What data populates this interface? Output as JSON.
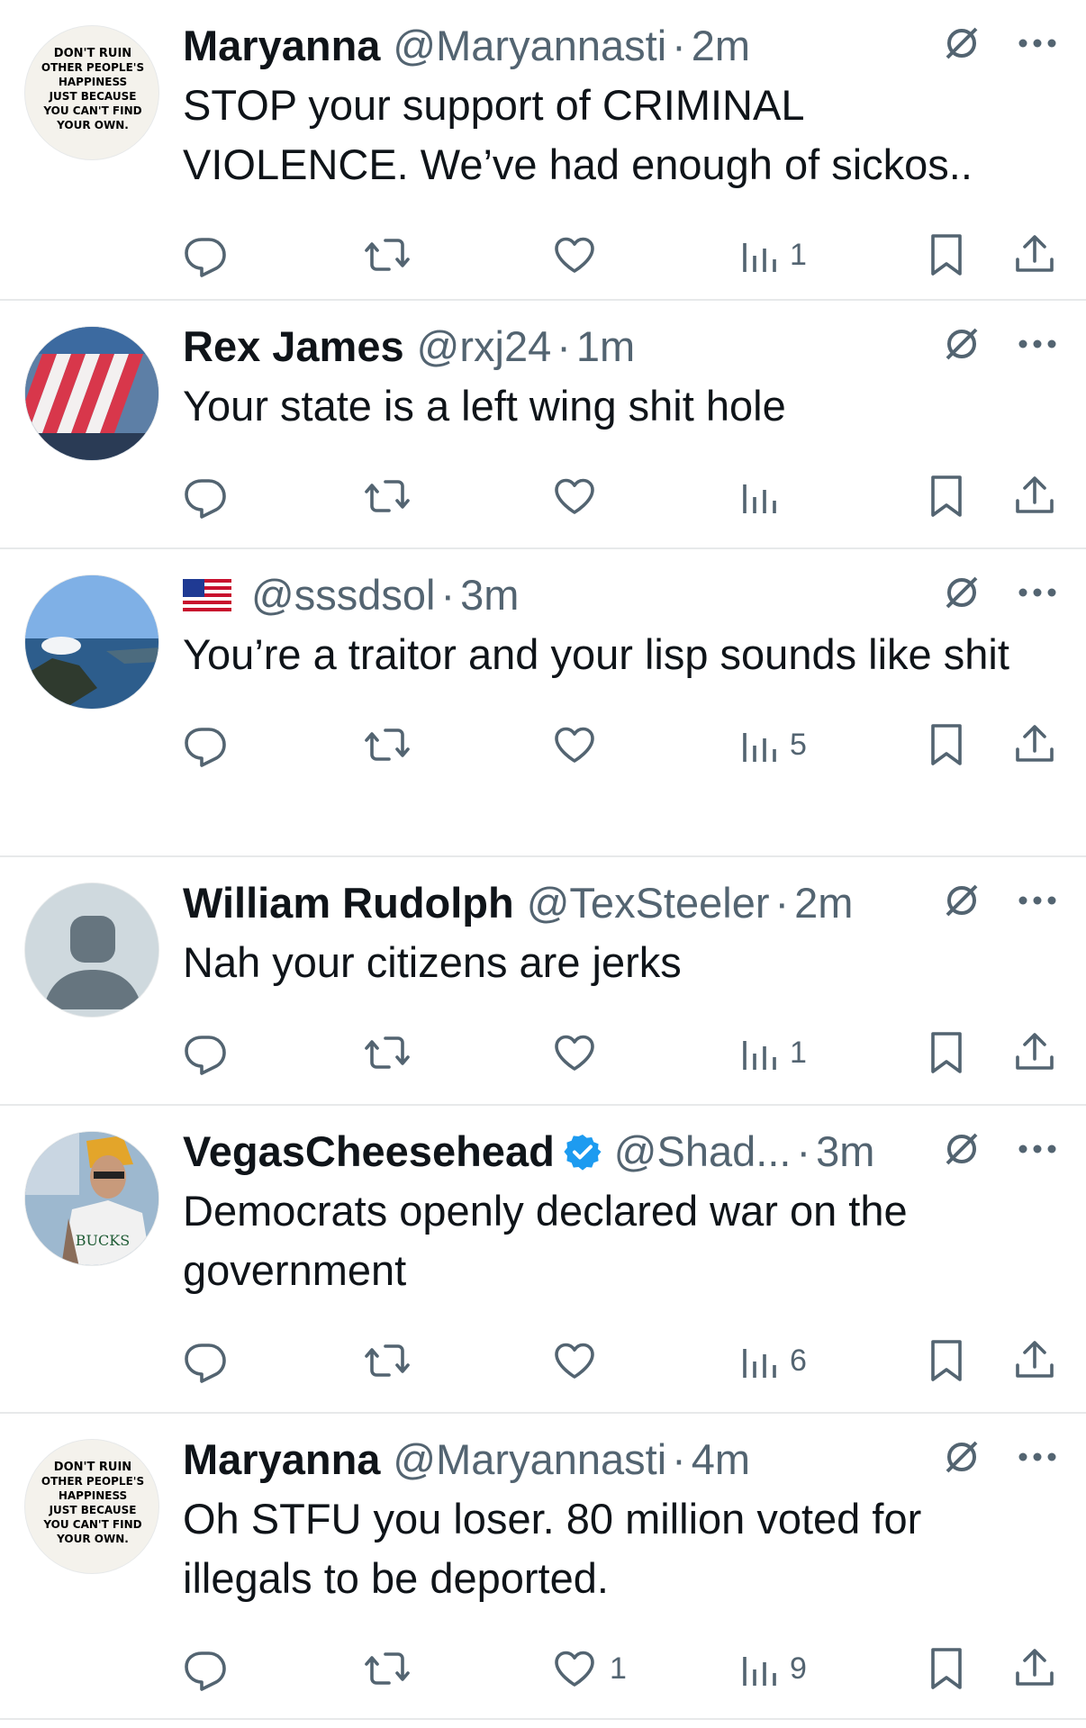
{
  "tweets": [
    {
      "name": "Maryanna",
      "handle": "@Maryannasti",
      "dot": "·",
      "time": "2m",
      "text": "STOP your support of CRIMINAL VIOLENCE.  We’ve had enough of sickos..",
      "avatar": "poster-avatar",
      "avatar_lines": [
        "DON'T RUIN",
        "OTHER PEOPLE'S",
        "HAPPINESS",
        "JUST BECAUSE",
        "YOU CAN'T FIND",
        "YOUR OWN."
      ],
      "replies": "",
      "reposts": "",
      "likes": "",
      "views": "1"
    },
    {
      "name": "Rex James",
      "handle": "@rxj24",
      "dot": "·",
      "time": "1m",
      "text": "Your state is a left wing shit hole",
      "avatar": "flag-stadium-avatar",
      "replies": "",
      "reposts": "",
      "likes": "",
      "views": ""
    },
    {
      "name": "",
      "handle": "@sssdsol",
      "dot": "·",
      "time": "3m",
      "text": "You’re a traitor and your lisp sounds like shit",
      "avatar": "landscape-avatar",
      "flag": "us-flag-emoji",
      "replies": "",
      "reposts": "",
      "likes": "",
      "views": "5"
    },
    {
      "name": "William Rudolph",
      "handle": "@TexSteeler",
      "dot": "·",
      "time": "2m",
      "text": "Nah your citizens are jerks",
      "avatar": "default-avatar",
      "replies": "",
      "reposts": "",
      "likes": "",
      "views": "1"
    },
    {
      "name": "VegasCheesehead",
      "handle": "@Shad...",
      "dot": "·",
      "time": "3m",
      "text": "Democrats openly declared war on the government",
      "avatar": "photo-avatar",
      "verified": true,
      "avatar_jersey": "BUCKS",
      "replies": "",
      "reposts": "",
      "likes": "",
      "views": "6"
    },
    {
      "name": "Maryanna",
      "handle": "@Maryannasti",
      "dot": "·",
      "time": "4m",
      "text": "Oh STFU you loser.  80 million voted for illegals to be deported.",
      "avatar": "poster-avatar",
      "avatar_lines": [
        "DON'T RUIN",
        "OTHER PEOPLE'S",
        "HAPPINESS",
        "JUST BECAUSE",
        "YOU CAN'T FIND",
        "YOUR OWN."
      ],
      "replies": "",
      "reposts": "",
      "likes": "1",
      "views": "9"
    }
  ],
  "icons": {
    "mute": "grok-slash-icon",
    "more": "more-dots-icon",
    "reply": "reply-icon",
    "repost": "repost-icon",
    "like": "heart-icon",
    "views": "views-icon",
    "bookmark": "bookmark-icon",
    "share": "share-icon"
  },
  "colors": {
    "text": "#0f1419",
    "secondary": "#536471",
    "divider": "#e7e9ea",
    "verified": "#1d9bf0"
  }
}
